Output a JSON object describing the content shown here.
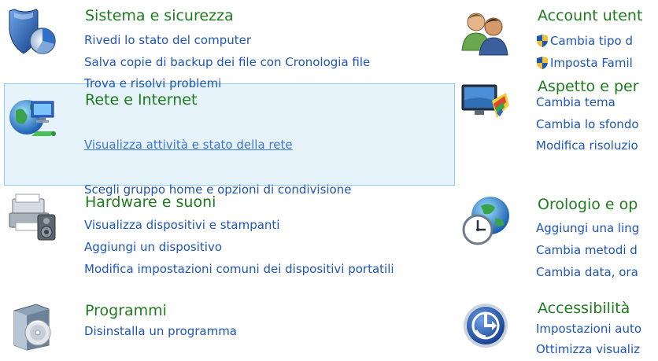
{
  "left": [
    {
      "title": "Sistema e sicurezza",
      "icon": "security-shield-icon",
      "links": [
        "Rivedi lo stato del computer",
        "Salva copie di backup dei file con Cronologia file",
        "Trova e risolvi problemi"
      ]
    },
    {
      "title": "Rete e Internet",
      "icon": "network-globe-icon",
      "links": [
        "Visualizza attività e stato della rete",
        "Scegli gruppo home e opzioni di condivisione"
      ]
    },
    {
      "title": "Hardware e suoni",
      "icon": "printer-speaker-icon",
      "links": [
        "Visualizza dispositivi e stampanti",
        "Aggiungi un dispositivo",
        "Modifica impostazioni comuni dei dispositivi portatili"
      ]
    },
    {
      "title": "Programmi",
      "icon": "programs-disc-box-icon",
      "links": [
        "Disinstalla un programma"
      ]
    }
  ],
  "right": [
    {
      "title": "Account utent",
      "icon": "user-accounts-icon",
      "links": [
        "Cambia tipo d",
        "Imposta Famil"
      ]
    },
    {
      "title": "Aspetto e per",
      "icon": "monitor-palette-icon",
      "links": [
        "Cambia tema",
        "Cambia lo sfondo",
        "Modifica risoluzio"
      ]
    },
    {
      "title": "Orologio e op",
      "icon": "clock-globe-icon",
      "links": [
        "Aggiungi una ling",
        "Cambia metodi d",
        "Cambia data, ora"
      ]
    },
    {
      "title": "Accessibilità",
      "icon": "accessibility-icon",
      "links": [
        "Impostazioni auto",
        "Ottimizza visualiz"
      ]
    }
  ],
  "colors": {
    "title": "#1e7b1e",
    "link": "#1e56b8",
    "highlight_bg": "#e6f3fb",
    "highlight_border": "#8ecaf0"
  }
}
